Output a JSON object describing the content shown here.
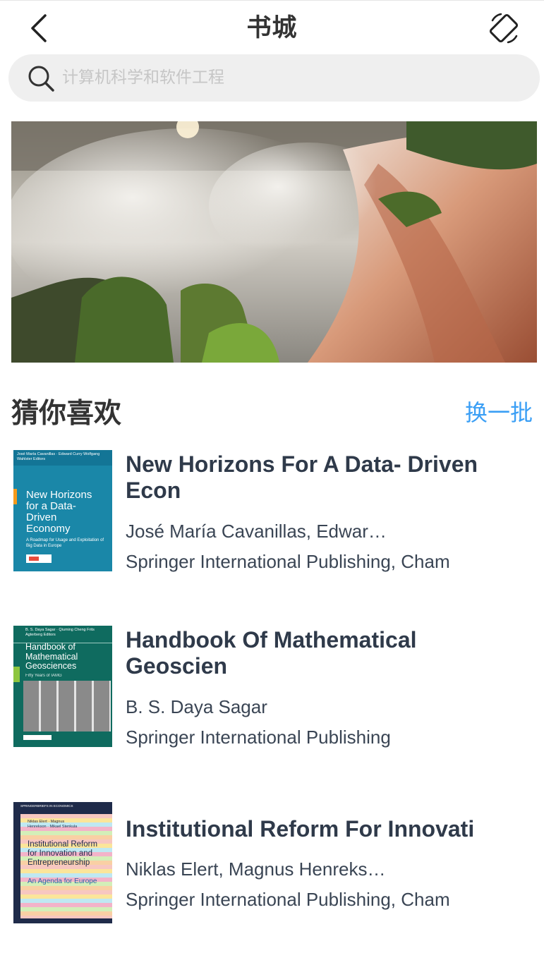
{
  "header": {
    "title": "书城",
    "back_icon": "chevron-left-icon",
    "rotate_icon": "rotate-screen-icon"
  },
  "search": {
    "placeholder": "计算机科学和软件工程",
    "value": ""
  },
  "banner": {
    "image": "waterfall-landscape"
  },
  "recommend": {
    "title": "猜你喜欢",
    "refresh_label": "换一批",
    "accent_color": "#3b9ff5"
  },
  "books": [
    {
      "title": "New Horizons For A Data- Driven Econ",
      "author": "José María Cavanillas, Edwar…",
      "publisher": "Springer International Publishing, Cham",
      "cover": {
        "top_text": "José María Cavanillas · Edward Curry Wolfgang Wahlster  Editors",
        "title": "New Horizons for a Data-Driven Economy",
        "subtitle": "A Roadmap for Usage and Exploitation of Big Data in Europe",
        "color": "#1a87a8"
      }
    },
    {
      "title": "Handbook Of Mathematical Geoscien",
      "author": "B. S. Daya Sagar",
      "publisher": "Springer International Publishing",
      "cover": {
        "top_text": "B. S. Daya Sagar · Qiuming Cheng Frits Agterberg  Editors",
        "title": "Handbook of Mathematical Geosciences",
        "subtitle": "Fifty Years of IAMG",
        "color": "#0f6b5f"
      }
    },
    {
      "title": "Institutional Reform For Innovati",
      "author": "Niklas Elert, Magnus Henreks…",
      "publisher": "Springer International Publishing, Cham",
      "cover": {
        "top_text": "SPRINGERBRIEFS IN ECONOMICS",
        "authors": "Niklas Elert · Magnus Henrekson · Mikael Stenkula",
        "title": "Institutional Reform for Innovation and Entrepreneurship",
        "subtitle": "An Agenda for Europe",
        "color": "#1f2b4a"
      }
    }
  ]
}
